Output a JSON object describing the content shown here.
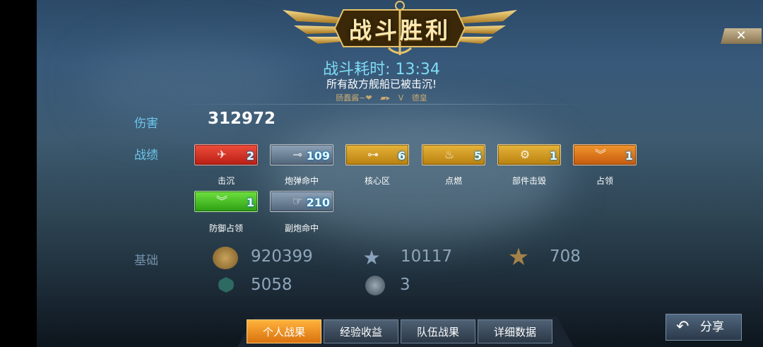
{
  "banner": {
    "title": "战斗胜利"
  },
  "close": {
    "label": "✕"
  },
  "battle": {
    "time_label": "战斗耗时:",
    "time_value": "13:34",
    "result": "所有敌方舰船已被击沉!",
    "player_left": "肠蠢酱~❤",
    "player_mid": "V",
    "player_right": "德皇"
  },
  "damage": {
    "label": "伤害",
    "value": "312972"
  },
  "record": {
    "label": "战绩",
    "badges": [
      {
        "name": "击沉",
        "count": "2",
        "color": "#d83424",
        "icon": "aircraft-icon"
      },
      {
        "name": "炮弹命中",
        "count": "109",
        "color": "#6b7f94",
        "icon": "shell-icon"
      },
      {
        "name": "核心区",
        "count": "6",
        "color": "#d09a22",
        "icon": "ship-core-icon"
      },
      {
        "name": "点燃",
        "count": "5",
        "color": "#d09a22",
        "icon": "fire-icon"
      },
      {
        "name": "部件击毁",
        "count": "1",
        "color": "#d09a22",
        "icon": "gear-icon"
      },
      {
        "name": "占领",
        "count": "1",
        "color": "#e07a1c",
        "icon": "chevron-icon"
      },
      {
        "name": "防御占领",
        "count": "1",
        "color": "#4ec22a",
        "icon": "chevron-icon"
      },
      {
        "name": "副炮命中",
        "count": "210",
        "color": "#6b7f94",
        "icon": "hand-icon"
      }
    ]
  },
  "base": {
    "label": "基础",
    "items": [
      {
        "icon": "coin-icon",
        "value": "920399"
      },
      {
        "icon": "star-icon",
        "value": "10117"
      },
      {
        "icon": "rank-star-icon",
        "value": "708"
      },
      {
        "icon": "exp-icon",
        "value": "5058"
      },
      {
        "icon": "token-icon",
        "value": "3"
      }
    ]
  },
  "tabs": [
    "个人战果",
    "经验收益",
    "队伍战果",
    "详细数据"
  ],
  "share": {
    "label": "分享"
  }
}
